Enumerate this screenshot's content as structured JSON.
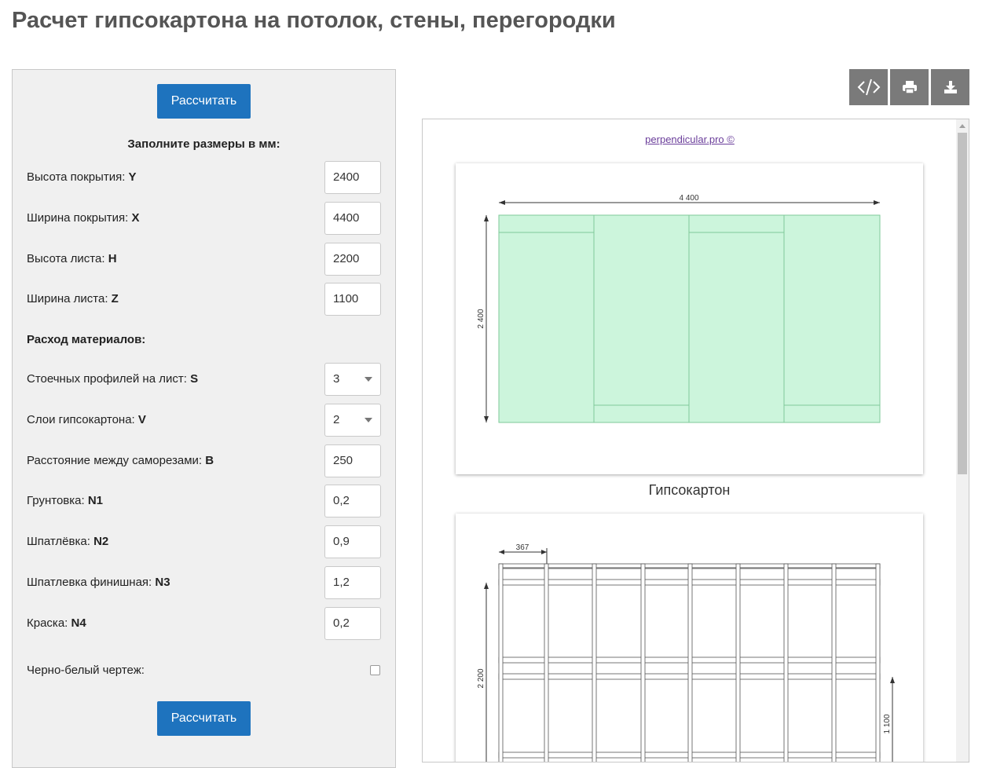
{
  "page": {
    "title": "Расчет гипсокартона на потолок, стены, перегородки"
  },
  "form": {
    "calc_button_label": "Рассчитать",
    "heading": "Заполните размеры в мм:",
    "cover_height": {
      "label": "Высота покрытия:",
      "var": "Y",
      "value": "2400"
    },
    "cover_width": {
      "label": "Ширина покрытия:",
      "var": "X",
      "value": "4400"
    },
    "sheet_height": {
      "label": "Высота листа:",
      "var": "H",
      "value": "2200"
    },
    "sheet_width": {
      "label": "Ширина листа:",
      "var": "Z",
      "value": "1100"
    },
    "materials_title": "Расход материалов:",
    "studs_per_sheet": {
      "label": "Стоечных профилей на лист:",
      "var": "S",
      "value": "3"
    },
    "layers": {
      "label": "Слои гипсокартона:",
      "var": "V",
      "value": "2"
    },
    "screw_spacing": {
      "label": "Расстояние между саморезами:",
      "var": "B",
      "value": "250"
    },
    "primer": {
      "label": "Грунтовка:",
      "var": "N1",
      "value": "0,2"
    },
    "putty": {
      "label": "Шпатлёвка:",
      "var": "N2",
      "value": "0,9"
    },
    "finish_putty": {
      "label": "Шпатлевка финишная:",
      "var": "N3",
      "value": "1,2"
    },
    "paint": {
      "label": "Краска:",
      "var": "N4",
      "value": "0,2"
    },
    "bw_drawing": {
      "label": "Черно-белый чертеж:",
      "checked": false
    }
  },
  "toolbar": {
    "icons": [
      "code-icon",
      "print-icon",
      "download-icon"
    ]
  },
  "drawing": {
    "credit": "perpendicular.pro ©",
    "sheet1": {
      "width_dim": "4 400",
      "height_dim": "2 400",
      "caption": "Гипсокартон",
      "fill_color": "#ccf5dc",
      "stroke_color": "#7fc99a"
    },
    "sheet2": {
      "step_dim": "367",
      "height_dim": "2 200",
      "sheet_dim": "1 100"
    }
  }
}
